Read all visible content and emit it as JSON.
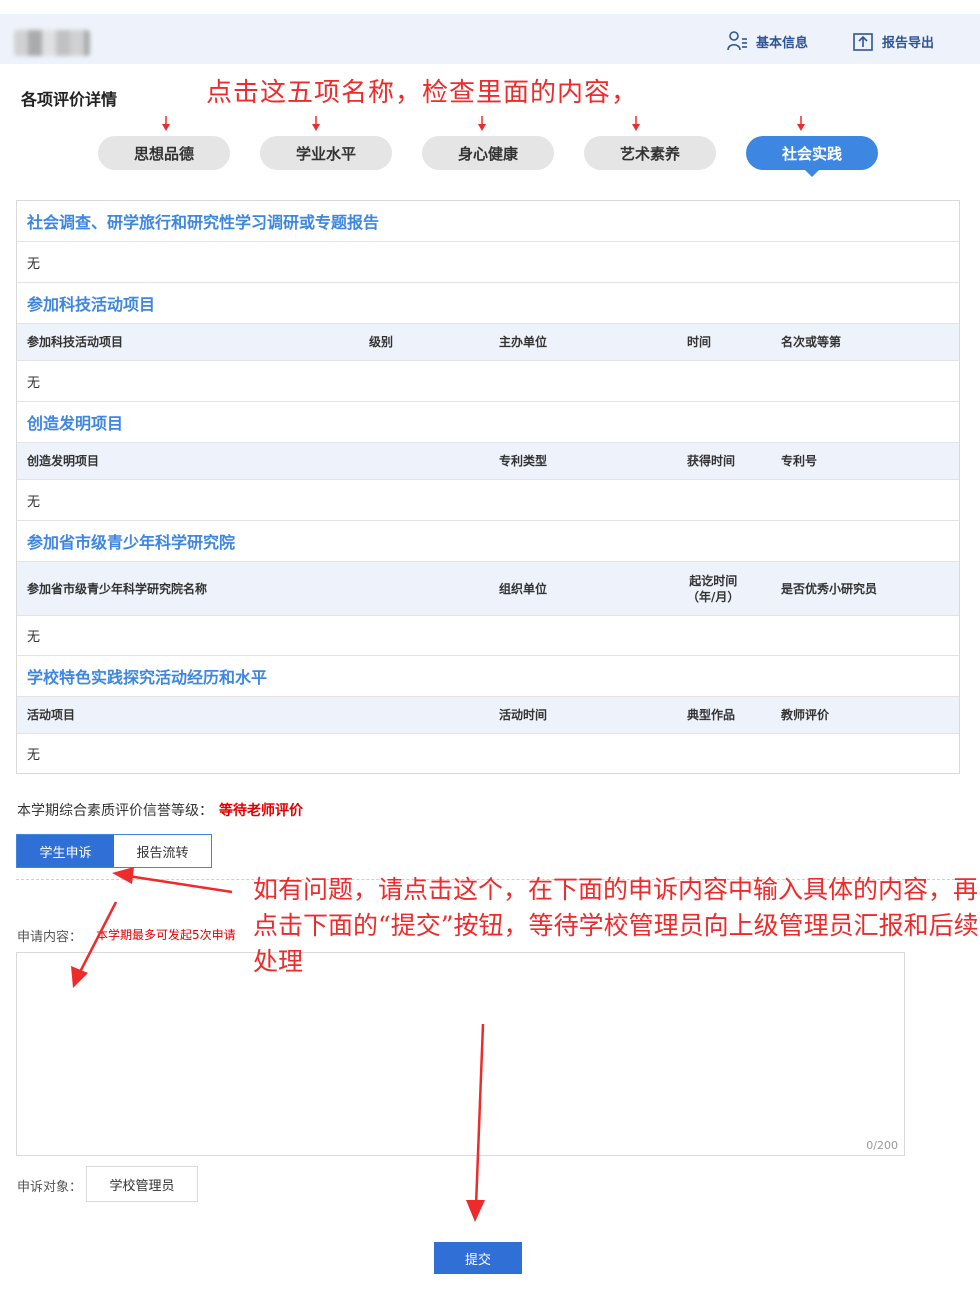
{
  "header": {
    "basic_info_label": "基本信息",
    "export_label": "报告导出"
  },
  "section_title": "各项评价详情",
  "annotations": {
    "top": "点击这五项名称，检查里面的内容，",
    "bottom": "如有问题，请点击这个，在下面的申诉内容中输入具体的内容，再点击下面的“提交”按钮，等待学校管理员向上级管理员汇报和后续处理"
  },
  "tabs": [
    {
      "label": "思想品德",
      "active": false
    },
    {
      "label": "学业水平",
      "active": false
    },
    {
      "label": "身心健康",
      "active": false
    },
    {
      "label": "艺术素养",
      "active": false
    },
    {
      "label": "社会实践",
      "active": true
    }
  ],
  "sections": {
    "report": {
      "title": "社会调查、研学旅行和研究性学习调研或专题报告",
      "value": "无"
    },
    "tech": {
      "title": "参加科技活动项目",
      "columns": [
        "参加科技活动项目",
        "级别",
        "主办单位",
        "时间",
        "名次或等第"
      ],
      "value": "无"
    },
    "invention": {
      "title": "创造发明项目",
      "columns": [
        "创造发明项目",
        "专利类型",
        "获得时间",
        "专利号"
      ],
      "value": "无"
    },
    "academy": {
      "title": "参加省市级青少年科学研究院",
      "columns": [
        "参加省市级青少年科学研究院名称",
        "组织单位",
        "起讫时间",
        "（年/月）",
        "是否优秀小研究员"
      ],
      "value": "无"
    },
    "school": {
      "title": "学校特色实践探究活动经历和水平",
      "columns": [
        "活动项目",
        "活动时间",
        "典型作品",
        "教师评价"
      ],
      "value": "无"
    }
  },
  "credit": {
    "label": "本学期综合素质评价信誉等级：",
    "value": "等待老师评价"
  },
  "segment": {
    "appeal_label": "学生申诉",
    "flow_label": "报告流转"
  },
  "appeal": {
    "label": "申请内容：",
    "hint": "本学期最多可发起5次申请",
    "text": "",
    "counter": "0/200"
  },
  "target": {
    "label": "申诉对象：",
    "value": "学校管理员"
  },
  "submit_label": "提交",
  "colors": {
    "accent": "#3d86e2",
    "annotation": "#ee2b2b",
    "alert": "#e00000"
  }
}
